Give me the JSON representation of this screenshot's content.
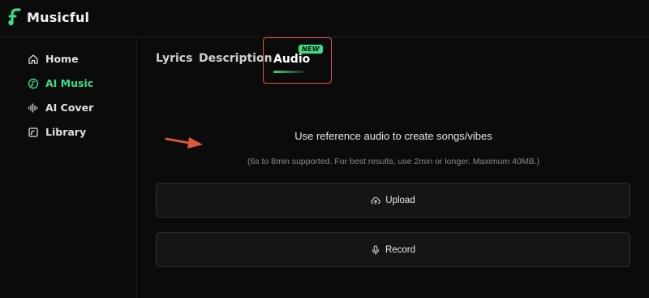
{
  "brand": {
    "name": "Musicful"
  },
  "sidebar": {
    "items": [
      {
        "label": "Home",
        "icon": "home-icon",
        "active": false
      },
      {
        "label": "AI Music",
        "icon": "music-disc-icon",
        "active": true
      },
      {
        "label": "AI Cover",
        "icon": "waveform-icon",
        "active": false
      },
      {
        "label": "Library",
        "icon": "library-icon",
        "active": false
      }
    ]
  },
  "tabs": {
    "items": [
      {
        "label": "Lyrics"
      },
      {
        "label": "Description"
      },
      {
        "label": "Audio",
        "badge": "NEW",
        "active": true
      }
    ]
  },
  "main": {
    "title": "Use reference audio to create songs/vibes",
    "subtitle": "(6s to 8min supported. For best results, use 2min or longer. Maximum 40MB.)",
    "upload_label": "Upload",
    "record_label": "Record"
  },
  "colors": {
    "accent": "#3ddc84",
    "highlight_border": "#e2563f",
    "background": "#0b0b0b"
  }
}
